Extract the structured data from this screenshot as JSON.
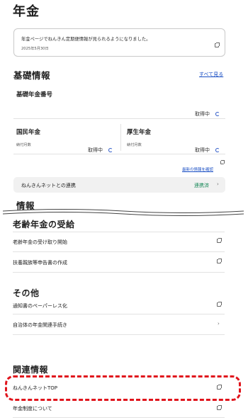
{
  "page": {
    "title": "年金"
  },
  "notice": {
    "text": "年金ページでねんきん定期便情報が見られるようになりました。",
    "date": "2025年5月30日",
    "icon": "external-link-icon"
  },
  "basic_info": {
    "heading": "基礎情報",
    "see_all": "すべて見る",
    "pension_number": {
      "label": "基礎年金番号",
      "status": "取得中"
    },
    "national_pension": {
      "label": "国民年金",
      "sub_label": "納付月数",
      "status": "取得中"
    },
    "employees_pension": {
      "label": "厚生年金",
      "sub_label": "納付月数",
      "status": "取得中"
    },
    "latest_link": "最新の情報を確認",
    "nenkin_net": {
      "label": "ねんきんネットとの連携",
      "status": "連携済"
    }
  },
  "info": {
    "heading": "情報"
  },
  "old_age": {
    "heading": "老齢年金の受給",
    "items": [
      {
        "label": "老齢年金の受け取り開始"
      },
      {
        "label": "扶養親族等申告書の作成"
      }
    ]
  },
  "other": {
    "heading": "その他",
    "items": [
      {
        "label": "通知書のペーパーレス化"
      },
      {
        "label": "自治体の年金関連手続き"
      }
    ]
  },
  "related": {
    "heading": "関連情報",
    "items": [
      {
        "label": "ねんきんネットTOP"
      },
      {
        "label": "年金制度について"
      }
    ]
  },
  "colors": {
    "accent": "#1a4fc4",
    "highlight": "#e0141c",
    "connected": "#1b8a5a"
  }
}
